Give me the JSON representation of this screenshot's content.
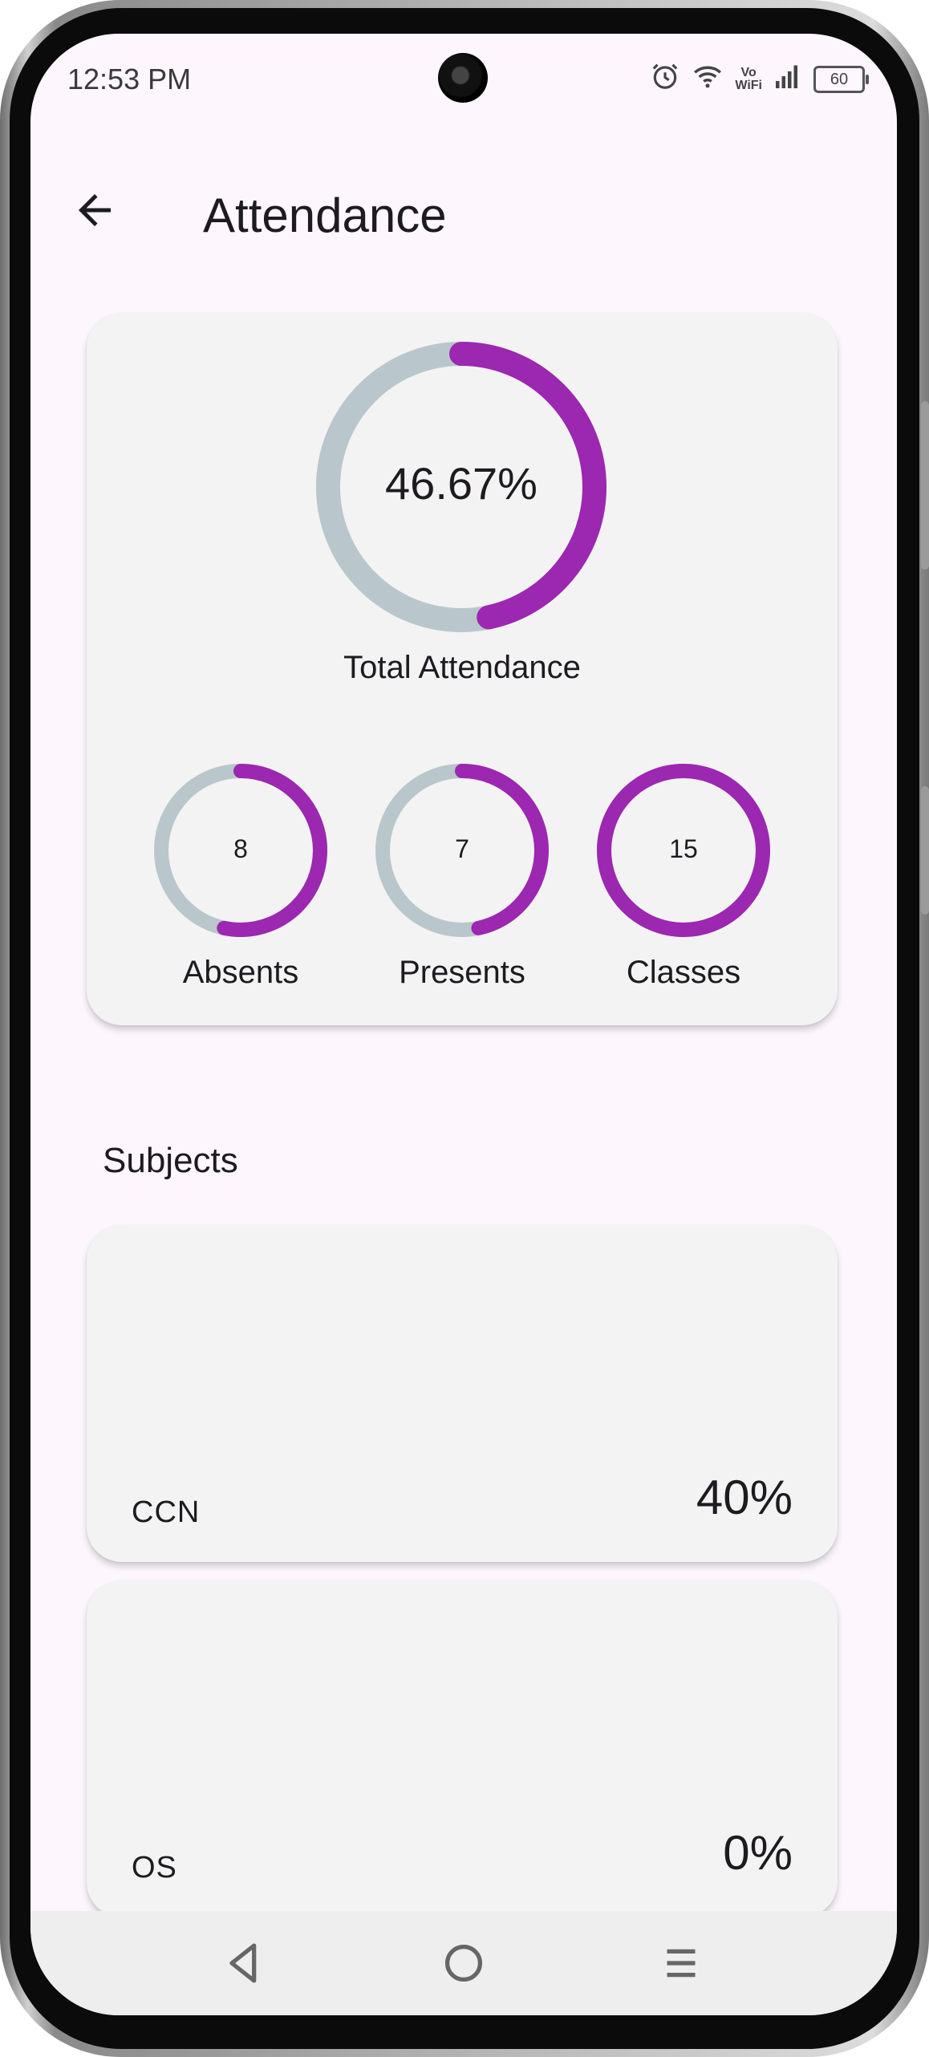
{
  "status_bar": {
    "time": "12:53 PM",
    "vowifi": "Vo\nWiFi",
    "battery": "60",
    "icons": [
      "alarm-icon",
      "wifi-icon",
      "vowifi-icon",
      "signal-icon",
      "battery-icon"
    ]
  },
  "app_bar": {
    "title": "Attendance",
    "back_icon": "arrow-back-icon"
  },
  "summary": {
    "total": {
      "value": "46.67%",
      "fraction": 0.4667,
      "label": "Total Attendance"
    },
    "stats": [
      {
        "value": "8",
        "label": "Absents",
        "fraction": 0.5333
      },
      {
        "value": "7",
        "label": "Presents",
        "fraction": 0.4667
      },
      {
        "value": "15",
        "label": "Classes",
        "fraction": 1.0
      }
    ]
  },
  "subjects": {
    "heading": "Subjects",
    "items": [
      {
        "name": "CCN",
        "percent": "40%"
      },
      {
        "name": "OS",
        "percent": "0%"
      }
    ]
  },
  "nav": {
    "icons": [
      "nav-back-icon",
      "nav-home-icon",
      "nav-menu-icon"
    ]
  },
  "colors": {
    "accent": "#9c27b0",
    "track": "#b9c7cc",
    "card": "#f3f3f3",
    "background": "#fdf6fd"
  }
}
